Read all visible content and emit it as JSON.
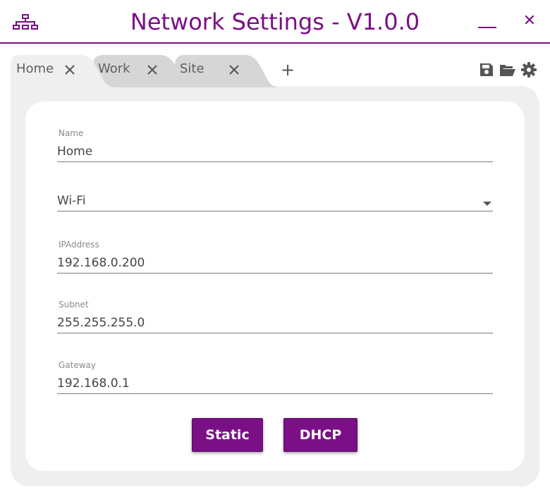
{
  "window": {
    "title": "Network Settings - V1.0.0",
    "minimize_icon": "minimize-icon",
    "close_icon": "close-icon",
    "app_icon": "network-icon",
    "accent_color": "#7b0f86"
  },
  "tabs": [
    {
      "label": "Home",
      "active": true
    },
    {
      "label": "Work",
      "active": false
    },
    {
      "label": "Site",
      "active": false
    }
  ],
  "tab_add_label": "+",
  "toolbar": {
    "save_icon": "save-icon",
    "open_icon": "folder-open-icon",
    "settings_icon": "gear-icon"
  },
  "form": {
    "name": {
      "label": "Name",
      "value": "Home"
    },
    "adapter": {
      "value": "Wi-Fi"
    },
    "ip": {
      "label": "IPAddress",
      "value": "192.168.0.200"
    },
    "subnet": {
      "label": "Subnet",
      "value": "255.255.255.0"
    },
    "gateway": {
      "label": "Gateway",
      "value": "192.168.0.1"
    }
  },
  "buttons": {
    "static_label": "Static",
    "dhcp_label": "DHCP"
  }
}
